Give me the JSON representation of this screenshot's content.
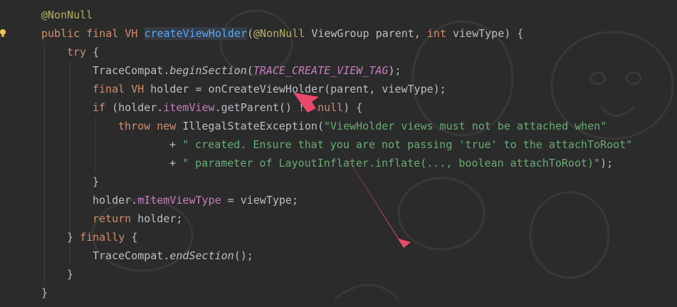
{
  "editor": {
    "lines": [
      {
        "indent": 0,
        "tokens": [
          {
            "t": "@NonNull",
            "c": "ann"
          }
        ]
      },
      {
        "indent": 0,
        "tokens": [
          {
            "t": "public ",
            "c": "kw"
          },
          {
            "t": "final ",
            "c": "kw"
          },
          {
            "t": "VH ",
            "c": "kw"
          },
          {
            "t": "createViewHolder",
            "c": "fn hl"
          },
          {
            "t": "(",
            "c": ""
          },
          {
            "t": "@NonNull ",
            "c": "ann"
          },
          {
            "t": "ViewGroup parent, ",
            "c": ""
          },
          {
            "t": "int ",
            "c": "kw"
          },
          {
            "t": "viewType) {",
            "c": ""
          }
        ]
      },
      {
        "indent": 1,
        "tokens": [
          {
            "t": "try ",
            "c": "kw"
          },
          {
            "t": "{",
            "c": ""
          }
        ]
      },
      {
        "indent": 2,
        "tokens": [
          {
            "t": "TraceCompat.",
            "c": ""
          },
          {
            "t": "beginSection",
            "c": "static-call"
          },
          {
            "t": "(",
            "c": ""
          },
          {
            "t": "TRACE_CREATE_VIEW_TAG",
            "c": "const"
          },
          {
            "t": ");",
            "c": ""
          }
        ]
      },
      {
        "indent": 2,
        "tokens": [
          {
            "t": "final ",
            "c": "kw"
          },
          {
            "t": "VH ",
            "c": "kw"
          },
          {
            "t": "holder = onCreateViewHolder(parent, viewType);",
            "c": ""
          }
        ]
      },
      {
        "indent": 2,
        "tokens": [
          {
            "t": "if ",
            "c": "kw"
          },
          {
            "t": "(holder.",
            "c": ""
          },
          {
            "t": "itemView",
            "c": "field"
          },
          {
            "t": ".getParent() != ",
            "c": ""
          },
          {
            "t": "null",
            "c": "kw"
          },
          {
            "t": ") {",
            "c": ""
          }
        ]
      },
      {
        "indent": 3,
        "tokens": [
          {
            "t": "throw ",
            "c": "kw"
          },
          {
            "t": "new ",
            "c": "kw"
          },
          {
            "t": "IllegalStateException(",
            "c": ""
          },
          {
            "t": "\"ViewHolder views must not be attached when\"",
            "c": "str"
          }
        ]
      },
      {
        "indent": 5,
        "tokens": [
          {
            "t": "+ ",
            "c": ""
          },
          {
            "t": "\" created. Ensure that you are not passing 'true' to the attachToRoot\"",
            "c": "str"
          }
        ]
      },
      {
        "indent": 5,
        "tokens": [
          {
            "t": "+ ",
            "c": ""
          },
          {
            "t": "\" parameter of LayoutInflater.inflate(..., boolean attachToRoot)\"",
            "c": "str"
          },
          {
            "t": ");",
            "c": ""
          }
        ]
      },
      {
        "indent": 2,
        "tokens": [
          {
            "t": "}",
            "c": ""
          }
        ]
      },
      {
        "indent": 2,
        "tokens": [
          {
            "t": "holder.",
            "c": ""
          },
          {
            "t": "mItemViewType",
            "c": "field"
          },
          {
            "t": " = viewType;",
            "c": ""
          }
        ]
      },
      {
        "indent": 2,
        "tokens": [
          {
            "t": "return ",
            "c": "kw"
          },
          {
            "t": "holder;",
            "c": ""
          }
        ]
      },
      {
        "indent": 1,
        "tokens": [
          {
            "t": "} ",
            "c": ""
          },
          {
            "t": "finally ",
            "c": "kw"
          },
          {
            "t": "{",
            "c": ""
          }
        ]
      },
      {
        "indent": 2,
        "tokens": [
          {
            "t": "TraceCompat.",
            "c": ""
          },
          {
            "t": "endSection",
            "c": "static-call"
          },
          {
            "t": "();",
            "c": ""
          }
        ]
      },
      {
        "indent": 1,
        "tokens": [
          {
            "t": "}",
            "c": ""
          }
        ]
      },
      {
        "indent": 0,
        "tokens": [
          {
            "t": "}",
            "c": ""
          }
        ]
      }
    ],
    "gutter_icon": "lightbulb-icon",
    "annotation_arrow_color": "#e8486a"
  }
}
